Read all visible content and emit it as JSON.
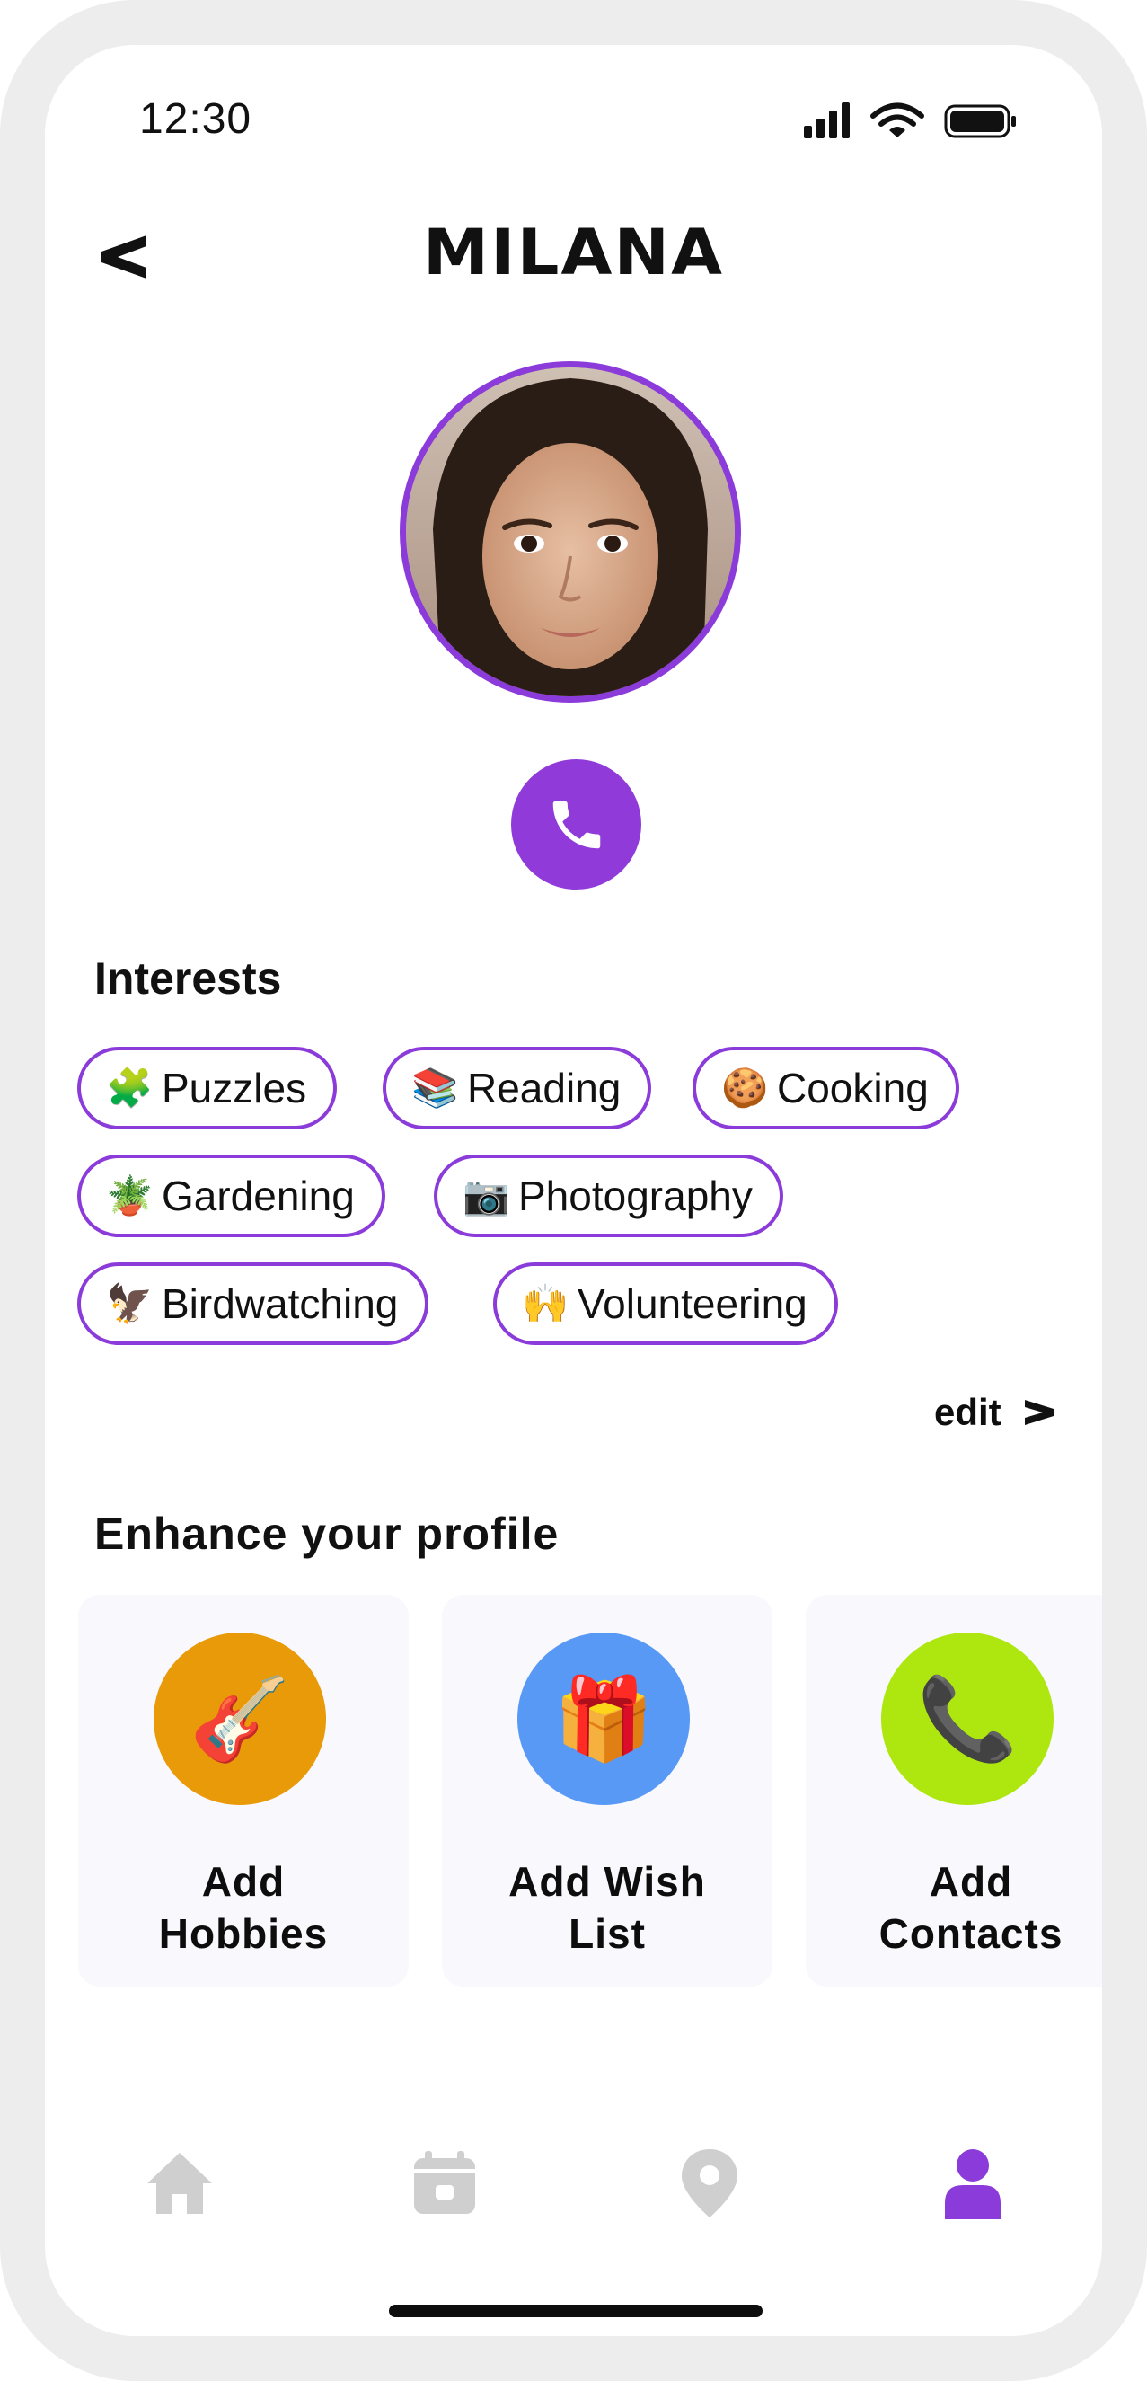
{
  "status_bar": {
    "time": "12:30"
  },
  "header": {
    "title": "MILANA"
  },
  "interests": {
    "title": "Interests",
    "chips": [
      {
        "emoji": "🧩",
        "label": "Puzzles"
      },
      {
        "emoji": "📚",
        "label": "Reading"
      },
      {
        "emoji": "🍪",
        "label": "Cooking"
      },
      {
        "emoji": "🪴",
        "label": "Gardening"
      },
      {
        "emoji": "📷",
        "label": "Photography"
      },
      {
        "emoji": "🦅",
        "label": "Birdwatching"
      },
      {
        "emoji": "🙌",
        "label": "Volunteering"
      }
    ],
    "edit_label": "edit"
  },
  "enhance": {
    "title": "Enhance your profile",
    "cards": [
      {
        "emoji": "🎸",
        "line1": "Add",
        "line2": "Hobbies",
        "color": "#e89a09"
      },
      {
        "emoji": "🎁",
        "line1": "Add Wish",
        "line2": "List",
        "color": "#5899f5"
      },
      {
        "emoji": "📞",
        "line1": "Add",
        "line2": "Contacts",
        "color": "#aee60f"
      }
    ]
  },
  "nav": {
    "items": [
      "home-icon",
      "calendar-icon",
      "location-icon",
      "profile-icon"
    ],
    "active": "profile-icon",
    "active_color": "#8b3bd9",
    "inactive_color": "#cfcfcf"
  },
  "colors": {
    "accent": "#8b3bd9"
  }
}
